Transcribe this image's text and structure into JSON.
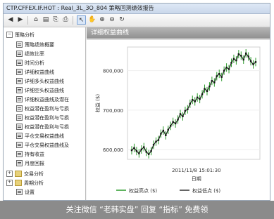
{
  "window": {
    "title": "CTP.CFFEX.IF.HOT : Real_3L_3O_804 策略回测绩效报告"
  },
  "toolbar": {
    "buttons": [
      "back-icon",
      "forward-icon",
      "home-icon",
      "save-icon",
      "copy-icon",
      "print-icon",
      "cursor-icon",
      "hand-icon",
      "zoom-in-icon",
      "zoom-out-icon",
      "refresh-icon"
    ]
  },
  "sidebar": {
    "root_label": "策略分析",
    "items": [
      {
        "label": "策略绩效概要"
      },
      {
        "label": "绩效比率"
      },
      {
        "label": "时间分析"
      },
      {
        "label": "详细权益曲线"
      },
      {
        "label": "详细多头权益曲线"
      },
      {
        "label": "详细空头权益曲线"
      },
      {
        "label": "详细权益曲线及潜在"
      },
      {
        "label": "权益潜在盈利与亏损"
      },
      {
        "label": "权益潜在盈利与亏损"
      },
      {
        "label": "权益潜在盈利与亏损"
      },
      {
        "label": "平仓交易权益曲线"
      },
      {
        "label": "平仓交易权益曲线及"
      },
      {
        "label": "持有收益"
      },
      {
        "label": "月度回报"
      }
    ],
    "sections": [
      {
        "label": "交易分析"
      },
      {
        "label": "周期分析"
      },
      {
        "label": "设置"
      }
    ]
  },
  "panel": {
    "title": "详细权益曲线"
  },
  "chart_data": {
    "type": "line",
    "xlabel": "日期",
    "ylabel": "权益 ($)",
    "x_tick_label": "2011/11/8 15:01:30",
    "y_ticks": [
      600000,
      700000,
      800000
    ],
    "y_tick_labels": [
      "600,000",
      "700,000",
      "800,000"
    ],
    "ylim": [
      575000,
      860000
    ],
    "legend": [
      {
        "label": "权益高点 ($)",
        "color": "#2a9a2a"
      },
      {
        "label": "权益低点 ($)",
        "color": "#333333"
      }
    ],
    "series": [
      {
        "name": "权益",
        "values": [
          598000,
          604000,
          596000,
          590000,
          600000,
          606000,
          594000,
          588000,
          596000,
          612000,
          620000,
          624000,
          640000,
          648000,
          636000,
          650000,
          660000,
          670000,
          666000,
          676000,
          690000,
          684000,
          698000,
          702000,
          716000,
          726000,
          722000,
          732000,
          728000,
          740000,
          754000,
          748000,
          760000,
          774000,
          770000,
          786000,
          792000,
          784000,
          800000,
          808000,
          804000,
          820000,
          830000,
          826000,
          842000,
          838000,
          828000,
          844000,
          836000,
          824000,
          816000,
          822000
        ]
      }
    ]
  },
  "bottom_banner": {
    "text": "关注微信 “老韩实盘” 回复 “指标” 免费领"
  }
}
